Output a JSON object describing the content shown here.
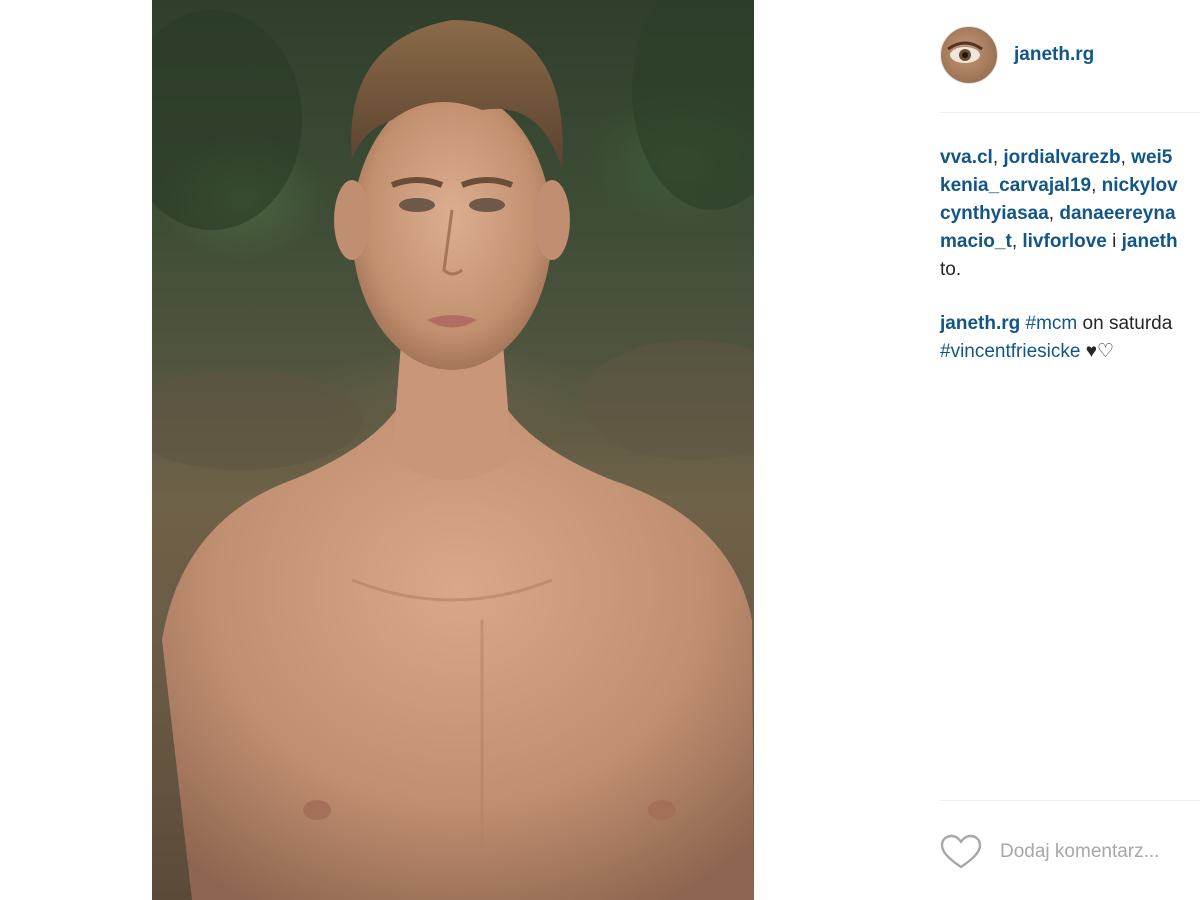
{
  "post": {
    "author": "janeth.rg",
    "author_avatar_icon": "eye-avatar-photo",
    "photo_description_icon": "shirtless-man-photo"
  },
  "likes": {
    "users": [
      "vva.cl",
      "jordialvarezb",
      "wei5",
      "kenia_carvajal19",
      "nickylov",
      "cynthyiasaa",
      "danaeereyna",
      "macio_t",
      "livforlove",
      "janeth"
    ],
    "separator": ", ",
    "conjunction": " i ",
    "suffix": "to."
  },
  "caption": {
    "author": "janeth.rg",
    "tag1": "#mcm",
    "text1": " on saturda",
    "tag2": "#vincentfriesicke",
    "text2": " ♥♡"
  },
  "actions": {
    "like_icon": "heart-outline-icon",
    "comment_placeholder": "Dodaj komentarz..."
  },
  "colors": {
    "link": "#125688",
    "text": "#262626",
    "placeholder": "#a5a7aa",
    "divider": "#efefef"
  }
}
